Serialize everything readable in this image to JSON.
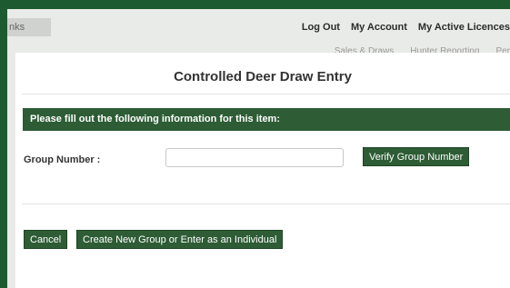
{
  "header": {
    "links_label": "nks",
    "nav": [
      "Log Out",
      "My Account",
      "My Active Licences"
    ],
    "sub_nav": [
      "Sales & Draws",
      "Hunter Reporting",
      "Per"
    ]
  },
  "modal": {
    "title": "Controlled Deer Draw Entry",
    "banner": "Please fill out the following information for this item:",
    "group_label": "Group Number :",
    "group_value": "",
    "verify_label": "Verify Group Number",
    "cancel_label": "Cancel",
    "create_label": "Create New Group or Enter as an Individual"
  },
  "colors": {
    "brand_green": "#2d5c35",
    "outer_green": "#1e5a30"
  }
}
